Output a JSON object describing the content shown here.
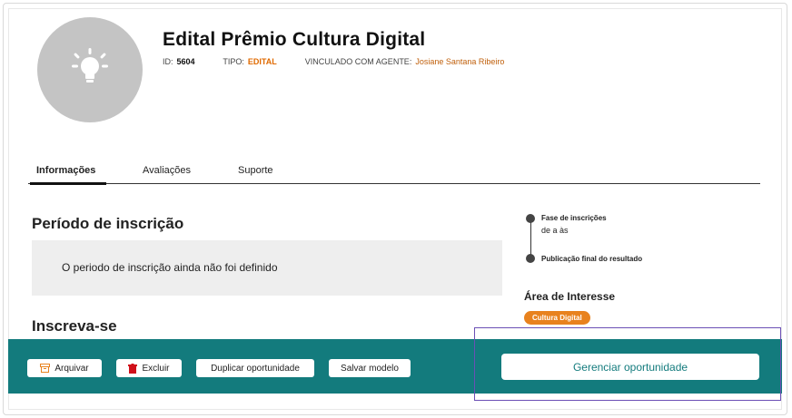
{
  "header": {
    "title": "Edital Prêmio Cultura Digital",
    "id_label": "ID:",
    "id_value": "5604",
    "type_label": "TIPO:",
    "type_value": "EDITAL",
    "agent_label": "VINCULADO COM AGENTE:",
    "agent_value": "Josiane Santana Ribeiro",
    "avatar_icon": "lightbulb-icon"
  },
  "tabs": [
    {
      "label": "Informações",
      "active": true
    },
    {
      "label": "Avaliações",
      "active": false
    },
    {
      "label": "Suporte",
      "active": false
    }
  ],
  "periodo": {
    "heading": "Período de inscrição",
    "message": "O periodo de inscrição ainda não foi definido"
  },
  "inscreva": {
    "heading": "Inscreva-se"
  },
  "timeline": {
    "phase1": "Fase de inscrições",
    "phase1_dates": "de a às",
    "phase2": "Publicação final do resultado"
  },
  "area": {
    "heading": "Área de Interesse",
    "tag": "Cultura Digital"
  },
  "actions": {
    "arquivar": "Arquivar",
    "excluir": "Excluir",
    "duplicar": "Duplicar oportunidade",
    "salvar": "Salvar modelo",
    "gerenciar": "Gerenciar oportunidade"
  },
  "colors": {
    "bar": "#137b7d",
    "accent": "#e8821e",
    "highlight": "#6b4fb5"
  }
}
